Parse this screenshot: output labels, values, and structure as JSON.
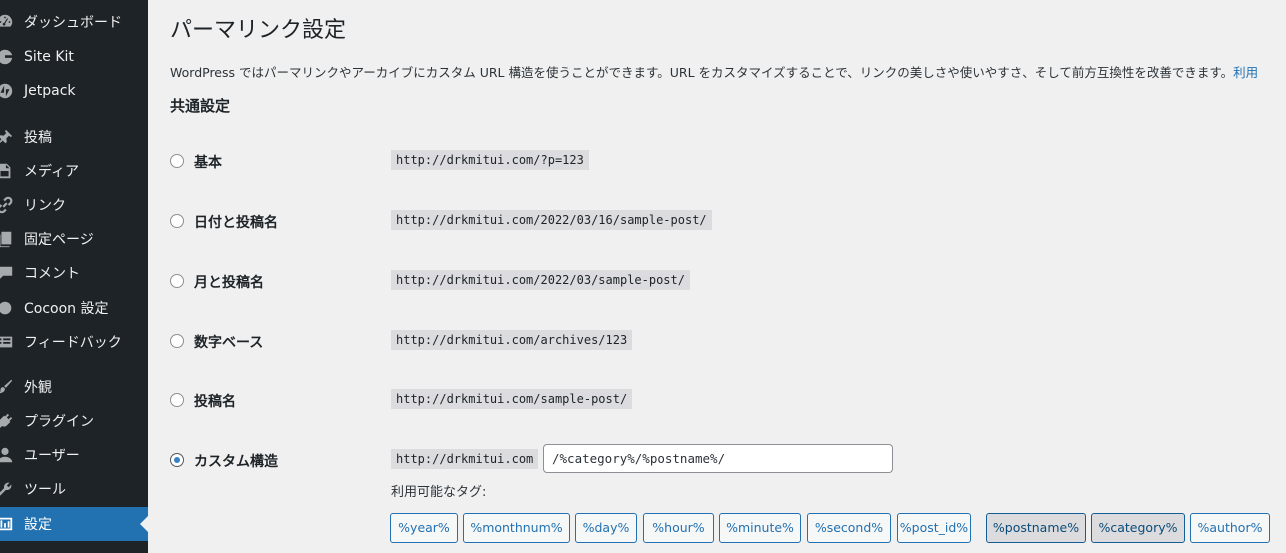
{
  "sidebar": {
    "items": [
      {
        "label": "ダッシュボード",
        "icon": "dashboard-icon"
      },
      {
        "label": "Site Kit",
        "icon": "site-kit-icon"
      },
      {
        "label": "Jetpack",
        "icon": "jetpack-icon"
      },
      {
        "label": "投稿",
        "icon": "pin-icon"
      },
      {
        "label": "メディア",
        "icon": "media-icon"
      },
      {
        "label": "リンク",
        "icon": "link-icon"
      },
      {
        "label": "固定ページ",
        "icon": "page-icon"
      },
      {
        "label": "コメント",
        "icon": "comment-icon"
      },
      {
        "label": "Cocoon 設定",
        "icon": "cocoon-icon"
      },
      {
        "label": "フィードバック",
        "icon": "feedback-icon"
      },
      {
        "label": "外観",
        "icon": "brush-icon"
      },
      {
        "label": "プラグイン",
        "icon": "plugin-icon"
      },
      {
        "label": "ユーザー",
        "icon": "user-icon"
      },
      {
        "label": "ツール",
        "icon": "wrench-icon"
      },
      {
        "label": "設定",
        "icon": "settings-icon",
        "current": true
      }
    ]
  },
  "page": {
    "title": "パーマリンク設定",
    "description": "WordPress ではパーマリンクやアーカイブにカスタム URL 構造を使うことができます。URL をカスタマイズすることで、リンクの美しさや使いやすさ、そして前方互換性を改善できます。",
    "description_link": "利用",
    "section_title": "共通設定"
  },
  "permalink_options": [
    {
      "label": "基本",
      "example": "http://drkmitui.com/?p=123",
      "selected": false
    },
    {
      "label": "日付と投稿名",
      "example": "http://drkmitui.com/2022/03/16/sample-post/",
      "selected": false
    },
    {
      "label": "月と投稿名",
      "example": "http://drkmitui.com/2022/03/sample-post/",
      "selected": false
    },
    {
      "label": "数字ベース",
      "example": "http://drkmitui.com/archives/123",
      "selected": false
    },
    {
      "label": "投稿名",
      "example": "http://drkmitui.com/sample-post/",
      "selected": false
    },
    {
      "label": "カスタム構造",
      "example": "http://drkmitui.com",
      "selected": true
    }
  ],
  "custom_structure": {
    "value": "/%category%/%postname%/",
    "tags_label": "利用可能なタグ:",
    "tags": [
      {
        "label": "%year%",
        "active": false
      },
      {
        "label": "%monthnum%",
        "active": false
      },
      {
        "label": "%day%",
        "active": false
      },
      {
        "label": "%hour%",
        "active": false
      },
      {
        "label": "%minute%",
        "active": false
      },
      {
        "label": "%second%",
        "active": false
      },
      {
        "label": "%post_id%",
        "active": false
      },
      {
        "label": "%postname%",
        "active": true
      },
      {
        "label": "%category%",
        "active": true
      },
      {
        "label": "%author%",
        "active": false
      }
    ]
  },
  "colors": {
    "sidebar_bg": "#1d2327",
    "accent": "#2271b1",
    "page_bg": "#f0f0f1"
  }
}
